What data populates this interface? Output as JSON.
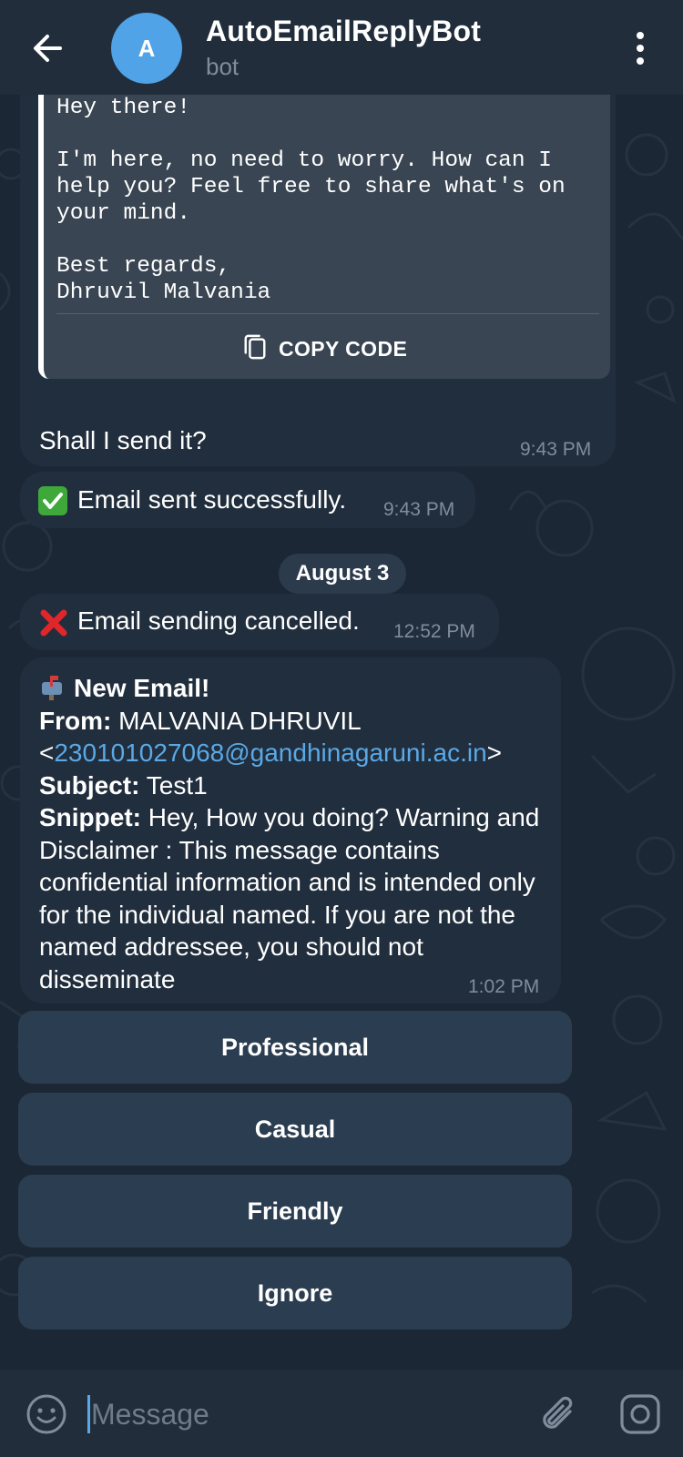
{
  "header": {
    "title": "AutoEmailReplyBot",
    "subtitle": "bot",
    "avatar_letter": "A"
  },
  "messages": {
    "draft": {
      "code_text": "Hey there!\n\nI'm here, no need to worry. How can I\nhelp you? Feel free to share what's on\nyour mind.\n\nBest regards,\nDhruvil Malvania",
      "copy_label": "COPY CODE",
      "text": "Shall I send it?",
      "time": "9:43 PM"
    },
    "sent": {
      "text": "Email sent successfully.",
      "time": "9:43 PM"
    },
    "date_separator": "August 3",
    "cancelled": {
      "text": "Email sending cancelled.",
      "time": "12:52 PM"
    },
    "new_email": {
      "heading": "New Email!",
      "from_label": "From:",
      "from_name": "MALVANIA DHRUVIL",
      "from_email": "230101027068@gandhinagaruni.ac.in",
      "subject_label": "Subject:",
      "subject": "Test1",
      "snippet_label": "Snippet:",
      "snippet": "Hey, How you doing? Warning and Disclaimer : This message contains confidential information and is intended only for the individual named. If you are not the named addressee, you should not disseminate",
      "time": "1:02 PM"
    }
  },
  "keyboard": [
    {
      "label": "Professional"
    },
    {
      "label": "Casual"
    },
    {
      "label": "Friendly"
    },
    {
      "label": "Ignore"
    }
  ],
  "input": {
    "placeholder": "Message"
  },
  "icons": {
    "back": "arrow-left-icon",
    "menu": "more-vertical-icon",
    "copy": "copy-icon",
    "check": "check-mark-button-icon",
    "cross": "cross-mark-icon",
    "mailbox": "mailbox-icon",
    "emoji": "smiley-icon",
    "attach": "paperclip-icon",
    "camera": "camera-icon"
  },
  "colors": {
    "background": "#1b2734",
    "header": "#212d3b",
    "bubble": "#212e3d",
    "link": "#5aa9e6",
    "button": "#2b3d50"
  }
}
